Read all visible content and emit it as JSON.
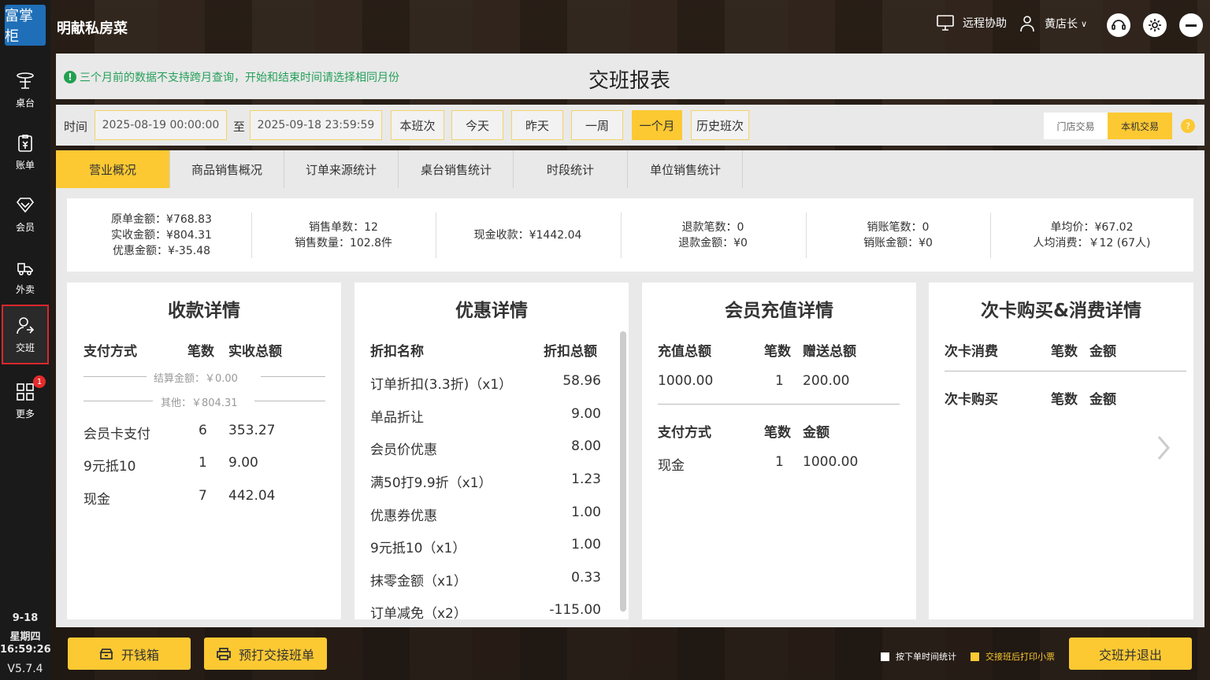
{
  "app": {
    "logo_text": "富掌柜",
    "store_name": "明献私房菜",
    "remote_help": "远程协助",
    "user_name": "黄店长",
    "version": "V5.7.4"
  },
  "sidebar": {
    "items": [
      {
        "label": "桌台",
        "icon": "table-icon"
      },
      {
        "label": "账单",
        "icon": "bill-icon"
      },
      {
        "label": "会员",
        "icon": "member-icon"
      },
      {
        "label": "外卖",
        "icon": "delivery-icon"
      },
      {
        "label": "交班",
        "icon": "shift-icon"
      },
      {
        "label": "更多",
        "icon": "more-grid-icon"
      }
    ],
    "more_badge": "1",
    "date": "9-18",
    "weekday": "星期四",
    "time": "16:59:26"
  },
  "header": {
    "notice": "三个月前的数据不支持跨月查询，开始和结束时间请选择相同月份",
    "title": "交班报表"
  },
  "filter": {
    "time_label": "时间",
    "start": "2025-08-19 00:00:00",
    "to_label": "至",
    "end": "2025-09-18 23:59:59",
    "quick_buttons": [
      "本班次",
      "今天",
      "昨天",
      "一周",
      "一个月",
      "历史班次"
    ],
    "active_quick": "一个月",
    "scope_options": [
      "门店交易",
      "本机交易"
    ],
    "active_scope": "本机交易",
    "help": "?"
  },
  "tabs": [
    "营业概况",
    "商品销售概况",
    "订单来源统计",
    "桌台销售统计",
    "时段统计",
    "单位销售统计"
  ],
  "summary": {
    "original_amount": "原单金额：¥768.83",
    "received_amount": "实收金额：¥804.31",
    "discount_amount": "优惠金额：¥-35.48",
    "sales_orders": "销售单数：12",
    "sales_qty": "销售数量：102.8件",
    "cash_received": "现金收款：¥1442.04",
    "refund_count": "退款笔数：0",
    "refund_amount": "退款金额：¥0",
    "writeoff_count": "销账笔数：0",
    "writeoff_amount": "销账金额：¥0",
    "avg_price": "单均价：¥67.02",
    "per_capita": "人均消费：￥12 (67人)"
  },
  "payment_card": {
    "title": "收款详情",
    "headers": [
      "支付方式",
      "笔数",
      "实收总额"
    ],
    "settle_line": "结算金额：￥0.00",
    "other_line": "其他：￥804.31",
    "rows": [
      [
        "会员卡支付",
        "6",
        "353.27"
      ],
      [
        "9元抵10",
        "1",
        "9.00"
      ],
      [
        "现金",
        "7",
        "442.04"
      ]
    ]
  },
  "discount_card": {
    "title": "优惠详情",
    "headers": [
      "折扣名称",
      "折扣总额"
    ],
    "rows": [
      [
        "订单折扣(3.3折)（x1）",
        "58.96"
      ],
      [
        "单品折让",
        "9.00"
      ],
      [
        "会员价优惠",
        "8.00"
      ],
      [
        "满50打9.9折（x1）",
        "1.23"
      ],
      [
        "优惠券优惠",
        "1.00"
      ],
      [
        "9元抵10（x1）",
        "1.00"
      ],
      [
        "抹零金额（x1）",
        "0.33"
      ],
      [
        "订单减免（x2）",
        "-115.00"
      ]
    ]
  },
  "recharge_card": {
    "title": "会员充值详情",
    "headers": [
      "充值总额",
      "笔数",
      "赠送总额"
    ],
    "row": [
      "1000.00",
      "1",
      "200.00"
    ],
    "pay_headers": [
      "支付方式",
      "笔数",
      "金额"
    ],
    "pay_row": [
      "现金",
      "1",
      "1000.00"
    ]
  },
  "timescard": {
    "title": "次卡购买&消费详情",
    "consume_headers": [
      "次卡消费",
      "笔数",
      "金额"
    ],
    "buy_headers": [
      "次卡购买",
      "笔数",
      "金额"
    ]
  },
  "bottom": {
    "cash_drawer": "开钱箱",
    "preprint": "预打交接班单",
    "chk_order_time": "按下单时间统计",
    "chk_print": "交接班后打印小票",
    "submit": "交班并退出"
  }
}
